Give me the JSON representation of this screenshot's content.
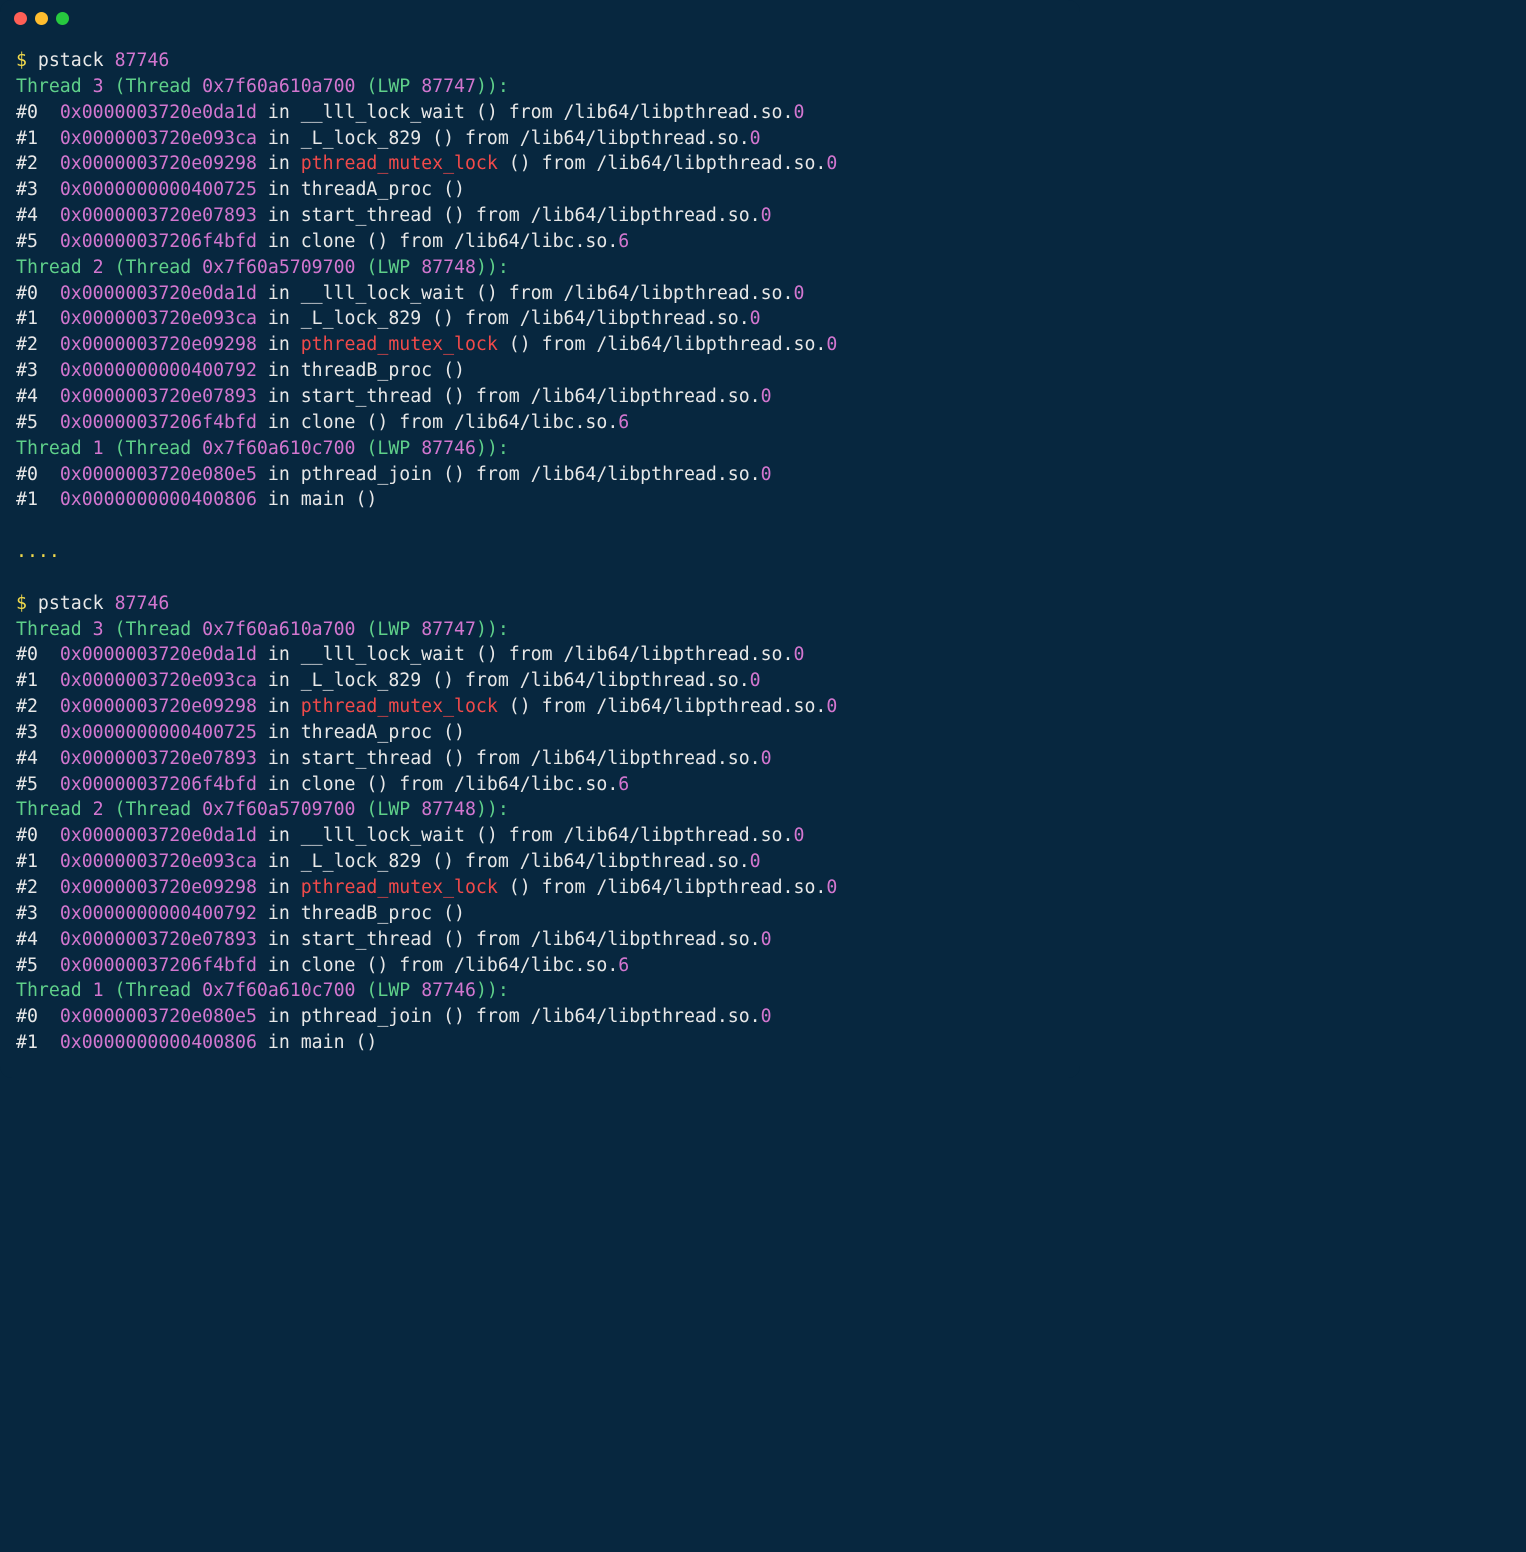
{
  "sessions": [
    {
      "prompt": {
        "sym": "$ ",
        "cmd": "pstack ",
        "arg": "87746"
      },
      "threads": [
        {
          "head": {
            "p1": "Thread ",
            "num": "3",
            "p2": " (Thread ",
            "addr": "0x7f60a610a700",
            "p3": " (LWP ",
            "lwp": "87747",
            "p4": ")):"
          },
          "frames": [
            [
              {
                "t": "#0  ",
                "c": "d"
              },
              {
                "t": "0x0000003720e0da1d",
                "c": "m"
              },
              {
                "t": " in __lll_lock_wait () from /lib64/libpthread.so.",
                "c": "d"
              },
              {
                "t": "0",
                "c": "m"
              }
            ],
            [
              {
                "t": "#1  ",
                "c": "d"
              },
              {
                "t": "0x0000003720e093ca",
                "c": "m"
              },
              {
                "t": " in _L_lock_829 () from /lib64/libpthread.so.",
                "c": "d"
              },
              {
                "t": "0",
                "c": "m"
              }
            ],
            [
              {
                "t": "#2  ",
                "c": "d"
              },
              {
                "t": "0x0000003720e09298",
                "c": "m"
              },
              {
                "t": " in ",
                "c": "d"
              },
              {
                "t": "pthread_mutex_lock",
                "c": "r"
              },
              {
                "t": " () from /lib64/libpthread.so.",
                "c": "d"
              },
              {
                "t": "0",
                "c": "m"
              }
            ],
            [
              {
                "t": "#3  ",
                "c": "d"
              },
              {
                "t": "0x0000000000400725",
                "c": "m"
              },
              {
                "t": " in threadA_proc ()",
                "c": "d"
              }
            ],
            [
              {
                "t": "#4  ",
                "c": "d"
              },
              {
                "t": "0x0000003720e07893",
                "c": "m"
              },
              {
                "t": " in start_thread () from /lib64/libpthread.so.",
                "c": "d"
              },
              {
                "t": "0",
                "c": "m"
              }
            ],
            [
              {
                "t": "#5  ",
                "c": "d"
              },
              {
                "t": "0x00000037206f4bfd",
                "c": "m"
              },
              {
                "t": " in clone () from /lib64/libc.so.",
                "c": "d"
              },
              {
                "t": "6",
                "c": "m"
              }
            ]
          ]
        },
        {
          "head": {
            "p1": "Thread ",
            "num": "2",
            "p2": " (Thread ",
            "addr": "0x7f60a5709700",
            "p3": " (LWP ",
            "lwp": "87748",
            "p4": ")):"
          },
          "frames": [
            [
              {
                "t": "#0  ",
                "c": "d"
              },
              {
                "t": "0x0000003720e0da1d",
                "c": "m"
              },
              {
                "t": " in __lll_lock_wait () from /lib64/libpthread.so.",
                "c": "d"
              },
              {
                "t": "0",
                "c": "m"
              }
            ],
            [
              {
                "t": "#1  ",
                "c": "d"
              },
              {
                "t": "0x0000003720e093ca",
                "c": "m"
              },
              {
                "t": " in _L_lock_829 () from /lib64/libpthread.so.",
                "c": "d"
              },
              {
                "t": "0",
                "c": "m"
              }
            ],
            [
              {
                "t": "#2  ",
                "c": "d"
              },
              {
                "t": "0x0000003720e09298",
                "c": "m"
              },
              {
                "t": " in ",
                "c": "d"
              },
              {
                "t": "pthread_mutex_lock",
                "c": "r"
              },
              {
                "t": " () from /lib64/libpthread.so.",
                "c": "d"
              },
              {
                "t": "0",
                "c": "m"
              }
            ],
            [
              {
                "t": "#3  ",
                "c": "d"
              },
              {
                "t": "0x0000000000400792",
                "c": "m"
              },
              {
                "t": " in threadB_proc ()",
                "c": "d"
              }
            ],
            [
              {
                "t": "#4  ",
                "c": "d"
              },
              {
                "t": "0x0000003720e07893",
                "c": "m"
              },
              {
                "t": " in start_thread () from /lib64/libpthread.so.",
                "c": "d"
              },
              {
                "t": "0",
                "c": "m"
              }
            ],
            [
              {
                "t": "#5  ",
                "c": "d"
              },
              {
                "t": "0x00000037206f4bfd",
                "c": "m"
              },
              {
                "t": " in clone () from /lib64/libc.so.",
                "c": "d"
              },
              {
                "t": "6",
                "c": "m"
              }
            ]
          ]
        },
        {
          "head": {
            "p1": "Thread ",
            "num": "1",
            "p2": " (Thread ",
            "addr": "0x7f60a610c700",
            "p3": " (LWP ",
            "lwp": "87746",
            "p4": ")):"
          },
          "frames": [
            [
              {
                "t": "#0  ",
                "c": "d"
              },
              {
                "t": "0x0000003720e080e5",
                "c": "m"
              },
              {
                "t": " in pthread_join () from /lib64/libpthread.so.",
                "c": "d"
              },
              {
                "t": "0",
                "c": "m"
              }
            ],
            [
              {
                "t": "#1  ",
                "c": "d"
              },
              {
                "t": "0x0000000000400806",
                "c": "m"
              },
              {
                "t": " in main ()",
                "c": "d"
              }
            ]
          ]
        }
      ]
    },
    {
      "prompt": {
        "sym": "$ ",
        "cmd": "pstack ",
        "arg": "87746"
      },
      "threads": [
        {
          "head": {
            "p1": "Thread ",
            "num": "3",
            "p2": " (Thread ",
            "addr": "0x7f60a610a700",
            "p3": " (LWP ",
            "lwp": "87747",
            "p4": ")):"
          },
          "frames": [
            [
              {
                "t": "#0  ",
                "c": "d"
              },
              {
                "t": "0x0000003720e0da1d",
                "c": "m"
              },
              {
                "t": " in __lll_lock_wait () from /lib64/libpthread.so.",
                "c": "d"
              },
              {
                "t": "0",
                "c": "m"
              }
            ],
            [
              {
                "t": "#1  ",
                "c": "d"
              },
              {
                "t": "0x0000003720e093ca",
                "c": "m"
              },
              {
                "t": " in _L_lock_829 () from /lib64/libpthread.so.",
                "c": "d"
              },
              {
                "t": "0",
                "c": "m"
              }
            ],
            [
              {
                "t": "#2  ",
                "c": "d"
              },
              {
                "t": "0x0000003720e09298",
                "c": "m"
              },
              {
                "t": " in ",
                "c": "d"
              },
              {
                "t": "pthread_mutex_lock",
                "c": "r"
              },
              {
                "t": " () from /lib64/libpthread.so.",
                "c": "d"
              },
              {
                "t": "0",
                "c": "m"
              }
            ],
            [
              {
                "t": "#3  ",
                "c": "d"
              },
              {
                "t": "0x0000000000400725",
                "c": "m"
              },
              {
                "t": " in threadA_proc ()",
                "c": "d"
              }
            ],
            [
              {
                "t": "#4  ",
                "c": "d"
              },
              {
                "t": "0x0000003720e07893",
                "c": "m"
              },
              {
                "t": " in start_thread () from /lib64/libpthread.so.",
                "c": "d"
              },
              {
                "t": "0",
                "c": "m"
              }
            ],
            [
              {
                "t": "#5  ",
                "c": "d"
              },
              {
                "t": "0x00000037206f4bfd",
                "c": "m"
              },
              {
                "t": " in clone () from /lib64/libc.so.",
                "c": "d"
              },
              {
                "t": "6",
                "c": "m"
              }
            ]
          ]
        },
        {
          "head": {
            "p1": "Thread ",
            "num": "2",
            "p2": " (Thread ",
            "addr": "0x7f60a5709700",
            "p3": " (LWP ",
            "lwp": "87748",
            "p4": ")):"
          },
          "frames": [
            [
              {
                "t": "#0  ",
                "c": "d"
              },
              {
                "t": "0x0000003720e0da1d",
                "c": "m"
              },
              {
                "t": " in __lll_lock_wait () from /lib64/libpthread.so.",
                "c": "d"
              },
              {
                "t": "0",
                "c": "m"
              }
            ],
            [
              {
                "t": "#1  ",
                "c": "d"
              },
              {
                "t": "0x0000003720e093ca",
                "c": "m"
              },
              {
                "t": " in _L_lock_829 () from /lib64/libpthread.so.",
                "c": "d"
              },
              {
                "t": "0",
                "c": "m"
              }
            ],
            [
              {
                "t": "#2  ",
                "c": "d"
              },
              {
                "t": "0x0000003720e09298",
                "c": "m"
              },
              {
                "t": " in ",
                "c": "d"
              },
              {
                "t": "pthread_mutex_lock",
                "c": "r"
              },
              {
                "t": " () from /lib64/libpthread.so.",
                "c": "d"
              },
              {
                "t": "0",
                "c": "m"
              }
            ],
            [
              {
                "t": "#3  ",
                "c": "d"
              },
              {
                "t": "0x0000000000400792",
                "c": "m"
              },
              {
                "t": " in threadB_proc ()",
                "c": "d"
              }
            ],
            [
              {
                "t": "#4  ",
                "c": "d"
              },
              {
                "t": "0x0000003720e07893",
                "c": "m"
              },
              {
                "t": " in start_thread () from /lib64/libpthread.so.",
                "c": "d"
              },
              {
                "t": "0",
                "c": "m"
              }
            ],
            [
              {
                "t": "#5  ",
                "c": "d"
              },
              {
                "t": "0x00000037206f4bfd",
                "c": "m"
              },
              {
                "t": " in clone () from /lib64/libc.so.",
                "c": "d"
              },
              {
                "t": "6",
                "c": "m"
              }
            ]
          ]
        },
        {
          "head": {
            "p1": "Thread ",
            "num": "1",
            "p2": " (Thread ",
            "addr": "0x7f60a610c700",
            "p3": " (LWP ",
            "lwp": "87746",
            "p4": ")):"
          },
          "frames": [
            [
              {
                "t": "#0  ",
                "c": "d"
              },
              {
                "t": "0x0000003720e080e5",
                "c": "m"
              },
              {
                "t": " in pthread_join () from /lib64/libpthread.so.",
                "c": "d"
              },
              {
                "t": "0",
                "c": "m"
              }
            ],
            [
              {
                "t": "#1  ",
                "c": "d"
              },
              {
                "t": "0x0000000000400806",
                "c": "m"
              },
              {
                "t": " in main ()",
                "c": "d"
              }
            ]
          ]
        }
      ]
    }
  ],
  "separator": "...."
}
